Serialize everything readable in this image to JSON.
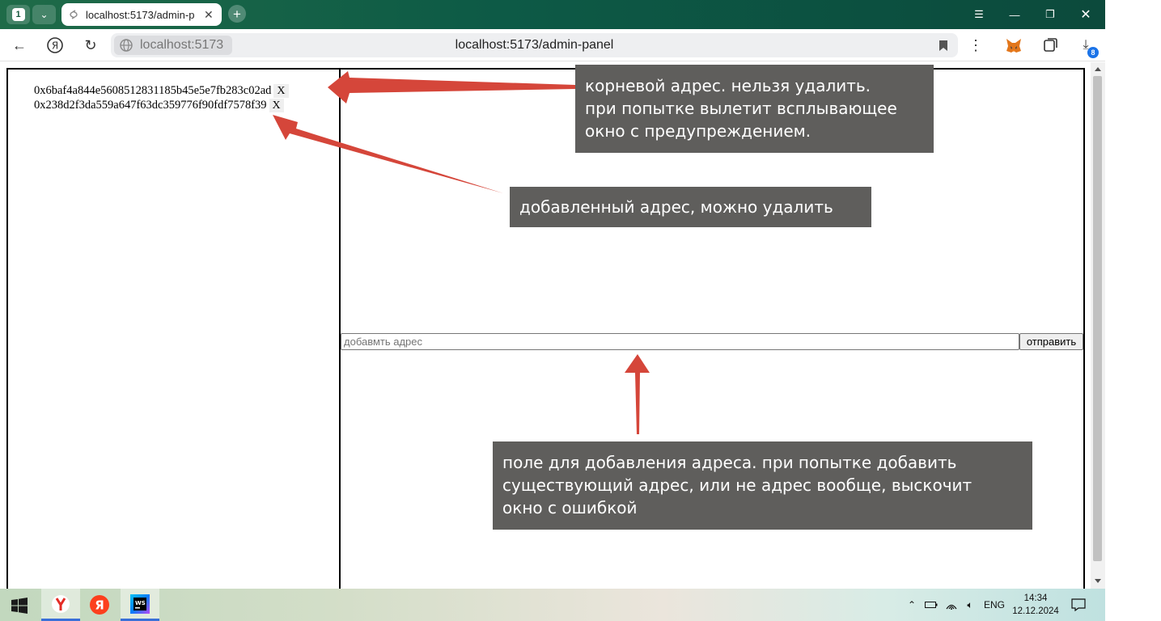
{
  "browser": {
    "tab_count": "1",
    "active_tab_title": "localhost:5173/admin-p",
    "omnibox_host": "localhost:5173",
    "url": "localhost:5173/admin-panel",
    "downloads_badge": "8"
  },
  "admin_panel": {
    "addresses": [
      {
        "address": "0x6baf4a844e5608512831185b45e5e7fb283c02ad",
        "delete_label": "X"
      },
      {
        "address": "0x238d2f3da559a647f63dc359776f90fdf7578f39",
        "delete_label": "X"
      }
    ],
    "input_placeholder": "добавмть адрес",
    "input_value": "",
    "submit_label": "отправить"
  },
  "annotations": {
    "root_address_note": "корневой адрес. нельзя удалить.\nпри попытке вылетит всплывающее\nокно с предупреждением.",
    "added_address_note": "добавленный адрес, можно удалить",
    "input_field_note": "поле для добавления адреса. при попытке добавить\nсуществующий адрес, или не адрес вообще, выскочит\nокно с ошибкой",
    "arrow_color": "#d5463a",
    "note_background": "#5f5e5c"
  },
  "taskbar": {
    "language": "ENG",
    "time": "14:34",
    "date": "12.12.2024",
    "apps": [
      "yandex-browser-icon",
      "yandex-icon",
      "webstorm-icon"
    ]
  }
}
